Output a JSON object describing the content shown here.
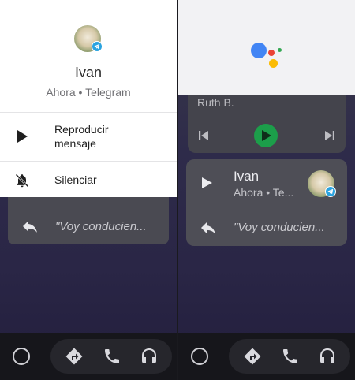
{
  "left": {
    "sheet": {
      "contact_name": "Ivan",
      "subtitle": "Ahora • Telegram",
      "items": [
        {
          "label": "Reproducir\nmensaje",
          "icon": "play-icon"
        },
        {
          "label": "Silenciar",
          "icon": "bell-off-icon"
        }
      ]
    },
    "reply_text": "\"Voy conducien..."
  },
  "right": {
    "assistant_colors": [
      "#4285F4",
      "#EA4335",
      "#FBBC05",
      "#34A853"
    ],
    "media": {
      "track_title": "Ruth B.",
      "play_color": "#1c9e4a"
    },
    "notification": {
      "contact_name": "Ivan",
      "subtitle": "Ahora • Te...",
      "reply_text": "\"Voy conducien..."
    }
  },
  "nav": {
    "icons": [
      "home-circle-icon",
      "navigation-icon",
      "phone-icon",
      "headphones-icon"
    ]
  }
}
